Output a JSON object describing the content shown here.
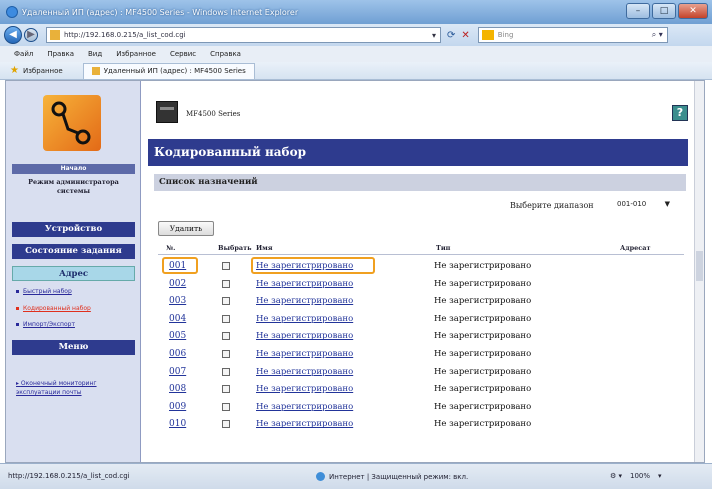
{
  "browser": {
    "title": "Удаленный ИП (адрес) : MF4500 Series - Windows Internet Explorer",
    "address": "http://192.168.0.215/a_list_cod.cgi",
    "search_placeholder": "Bing",
    "menu": [
      "Файл",
      "Правка",
      "Вид",
      "Избранное",
      "Сервис",
      "Справка"
    ],
    "favorites_label": "Избранное",
    "tab_label": "Удаленный ИП (адрес) : MF4500 Series",
    "status_url": "http://192.168.0.215/a_list_cod.cgi",
    "status_zone": "Интернет | Защищенный режим: вкл.",
    "zoom": "100%"
  },
  "sidebar": {
    "home_label": "Начало",
    "mode_label": "Режим администратора системы",
    "device_button": "Устройство",
    "jobs_button": "Состояние задания",
    "address_button": "Адрес",
    "links": [
      "Быстрый набор",
      "Кодированный набор",
      "Импорт/Экспорт"
    ],
    "menu_button": "Меню",
    "remote_link": "Оконечный мониторинг эксплуатации почты"
  },
  "main": {
    "device_name": "MF4500 Series",
    "page_title": "Кодированный набор",
    "section_title": "Список назначений",
    "range_label": "Выберите диапазон",
    "range_value": "001-010",
    "delete_button": "Удалить",
    "columns": {
      "no": "№.",
      "select": "Выбрать",
      "name": "Имя",
      "type": "Тип",
      "address": "Адресат"
    },
    "rows": [
      {
        "no": "001",
        "name": "Не зарегистрировано",
        "type": "Не зарегистрировано"
      },
      {
        "no": "002",
        "name": "Не зарегистрировано",
        "type": "Не зарегистрировано"
      },
      {
        "no": "003",
        "name": "Не зарегистрировано",
        "type": "Не зарегистрировано"
      },
      {
        "no": "004",
        "name": "Не зарегистрировано",
        "type": "Не зарегистрировано"
      },
      {
        "no": "005",
        "name": "Не зарегистрировано",
        "type": "Не зарегистрировано"
      },
      {
        "no": "006",
        "name": "Не зарегистрировано",
        "type": "Не зарегистрировано"
      },
      {
        "no": "007",
        "name": "Не зарегистрировано",
        "type": "Не зарегистрировано"
      },
      {
        "no": "008",
        "name": "Не зарегистрировано",
        "type": "Не зарегистрировано"
      },
      {
        "no": "009",
        "name": "Не зарегистрировано",
        "type": "Не зарегистрировано"
      },
      {
        "no": "010",
        "name": "Не зарегистрировано",
        "type": "Не зарегистрировано"
      }
    ]
  },
  "colors": {
    "nav_blue": "#2e3b8e",
    "link_blue": "#22349a",
    "highlight": "#f0a020",
    "active_link": "#e0301e"
  }
}
